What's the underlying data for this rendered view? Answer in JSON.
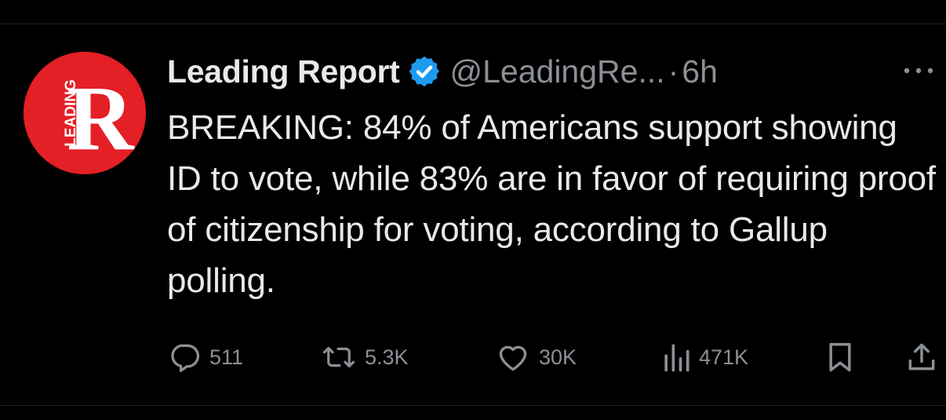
{
  "tweet": {
    "author": {
      "display_name": "Leading Report",
      "handle": "@LeadingRe...",
      "verified": true,
      "avatar_text": "LEADING",
      "avatar_letter": "R",
      "avatar_color": "#e41f26"
    },
    "separator": "·",
    "time": "6h",
    "text": "BREAKING: 84% of Americans support showing ID to vote, while 83% are in favor of requiring proof of citizenship for voting, according to Gallup polling.",
    "actions": {
      "replies": "511",
      "reposts": "5.3K",
      "likes": "30K",
      "views": "471K"
    },
    "icons": {
      "reply": "reply-icon",
      "repost": "repost-icon",
      "like": "heart-icon",
      "views": "views-icon",
      "bookmark": "bookmark-icon",
      "share": "share-icon",
      "more": "more-icon",
      "verified": "verified-badge-icon"
    }
  },
  "colors": {
    "background": "#000000",
    "text": "#e7e9ea",
    "muted": "#8b9096",
    "verified_blue": "#1d9bf0"
  }
}
